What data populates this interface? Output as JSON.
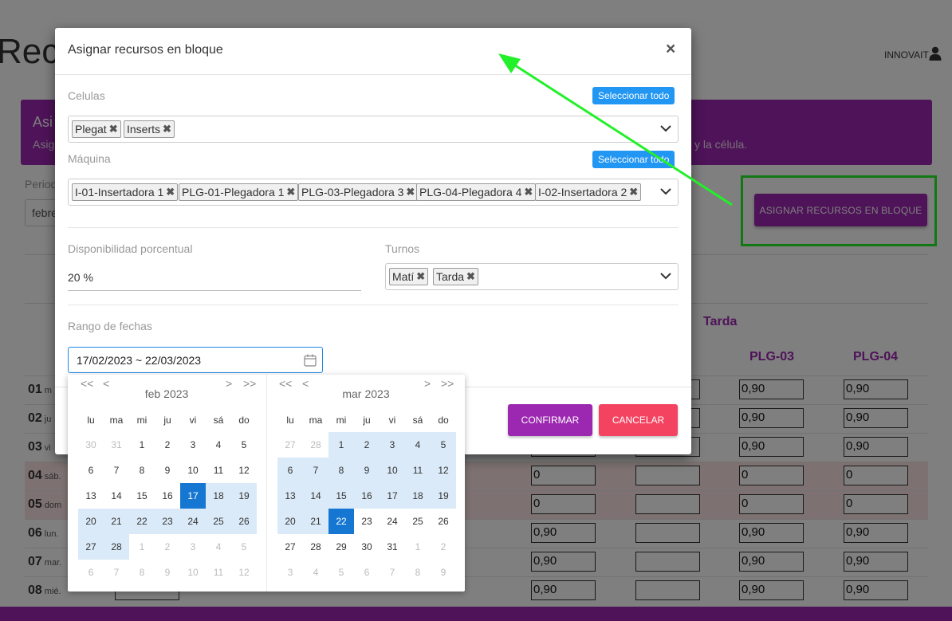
{
  "background": {
    "page_title": "Rec",
    "user_name": "INNOVAIT",
    "card_title": "Asi",
    "card_subtitle": "Asig",
    "card_subtitle_right": "y la célula.",
    "periodo_label": "Period",
    "periodo_value": "febre",
    "bulk_button_label": "ASIGNAR RECURSOS EN BLOQUE",
    "tarda_header": "Tarda",
    "column_headers": [
      "PLG-03",
      "PLG-04"
    ],
    "rows": [
      {
        "num": "01",
        "wd": "m",
        "vals": [
          "",
          "",
          "0,90",
          "0,90"
        ],
        "weekend": false
      },
      {
        "num": "02",
        "wd": "ju",
        "vals": [
          "",
          "",
          "0,90",
          "0,90"
        ],
        "weekend": false
      },
      {
        "num": "03",
        "wd": "vi",
        "vals": [
          "",
          "",
          "0,90",
          "0,90"
        ],
        "weekend": false
      },
      {
        "num": "04",
        "wd": "sáb.",
        "vals": [
          "0",
          "",
          "0",
          "0"
        ],
        "weekend": true
      },
      {
        "num": "05",
        "wd": "dom",
        "vals": [
          "0",
          "",
          "0",
          "0"
        ],
        "weekend": true
      },
      {
        "num": "06",
        "wd": "lun.",
        "vals": [
          "0,90",
          "",
          "0,90",
          "0,90"
        ],
        "weekend": false
      },
      {
        "num": "07",
        "wd": "mar.",
        "vals": [
          "0,90",
          "",
          "0,90",
          "0,90"
        ],
        "weekend": false
      },
      {
        "num": "08",
        "wd": "mié.",
        "vals": [
          "0,90",
          "",
          "0,90",
          "0,90"
        ],
        "weekend": false
      }
    ]
  },
  "modal": {
    "title": "Asignar recursos en bloque",
    "close_glyph": "×",
    "celulas": {
      "label": "Celulas",
      "select_all": "Seleccionar todo",
      "chips": [
        "Plegat",
        "Inserts"
      ]
    },
    "maquina": {
      "label": "Máquina",
      "select_all": "Seleccionar todo",
      "chips": [
        "I-01-Insertadora 1",
        "PLG-01-Plegadora 1",
        "PLG-03-Plegadora 3",
        "PLG-04-Plegadora 4",
        "I-02-Insertadora 2"
      ]
    },
    "disponibilidad": {
      "label": "Disponibilidad porcentual",
      "value": "20 %"
    },
    "turnos": {
      "label": "Turnos",
      "chips": [
        "Matí",
        "Tarda"
      ]
    },
    "rango": {
      "label": "Rango de fechas",
      "value": "17/02/2023 ~ 22/03/2023"
    },
    "confirm_label": "CONFIRMAR",
    "cancel_label": "CANCELAR",
    "chip_remove_glyph": "✖"
  },
  "calendar": {
    "weekdays": [
      "lu",
      "ma",
      "mi",
      "ju",
      "vi",
      "sá",
      "do"
    ],
    "nav": {
      "prev_year": "<<",
      "prev_month": "<",
      "next_month": ">",
      "next_year": ">>"
    },
    "left": {
      "month": "feb",
      "year": "2023",
      "days": [
        [
          "30",
          "m"
        ],
        [
          "31",
          "m"
        ],
        [
          "1",
          ""
        ],
        [
          "2",
          ""
        ],
        [
          "3",
          ""
        ],
        [
          "4",
          ""
        ],
        [
          "5",
          ""
        ],
        [
          "6",
          ""
        ],
        [
          "7",
          ""
        ],
        [
          "8",
          ""
        ],
        [
          "9",
          ""
        ],
        [
          "10",
          ""
        ],
        [
          "11",
          ""
        ],
        [
          "12",
          ""
        ],
        [
          "13",
          ""
        ],
        [
          "14",
          ""
        ],
        [
          "15",
          ""
        ],
        [
          "16",
          ""
        ],
        [
          "17",
          "s"
        ],
        [
          "18",
          "r"
        ],
        [
          "19",
          "r"
        ],
        [
          "20",
          "r"
        ],
        [
          "21",
          "r"
        ],
        [
          "22",
          "r"
        ],
        [
          "23",
          "r"
        ],
        [
          "24",
          "r"
        ],
        [
          "25",
          "r"
        ],
        [
          "26",
          "r"
        ],
        [
          "27",
          "r"
        ],
        [
          "28",
          "r"
        ],
        [
          "1",
          "m"
        ],
        [
          "2",
          "m"
        ],
        [
          "3",
          "m"
        ],
        [
          "4",
          "m"
        ],
        [
          "5",
          "m"
        ],
        [
          "6",
          "m"
        ],
        [
          "7",
          "m"
        ],
        [
          "8",
          "m"
        ],
        [
          "9",
          "m"
        ],
        [
          "10",
          "m"
        ],
        [
          "11",
          "m"
        ],
        [
          "12",
          "m"
        ]
      ]
    },
    "right": {
      "month": "mar",
      "year": "2023",
      "days": [
        [
          "27",
          "m"
        ],
        [
          "28",
          "m"
        ],
        [
          "1",
          "r"
        ],
        [
          "2",
          "r"
        ],
        [
          "3",
          "r"
        ],
        [
          "4",
          "r"
        ],
        [
          "5",
          "r"
        ],
        [
          "6",
          "r"
        ],
        [
          "7",
          "r"
        ],
        [
          "8",
          "r"
        ],
        [
          "9",
          "r"
        ],
        [
          "10",
          "r"
        ],
        [
          "11",
          "r"
        ],
        [
          "12",
          "r"
        ],
        [
          "13",
          "r"
        ],
        [
          "14",
          "r"
        ],
        [
          "15",
          "r"
        ],
        [
          "16",
          "r"
        ],
        [
          "17",
          "r"
        ],
        [
          "18",
          "r"
        ],
        [
          "19",
          "r"
        ],
        [
          "20",
          "r"
        ],
        [
          "21",
          "r"
        ],
        [
          "22",
          "s"
        ],
        [
          "23",
          ""
        ],
        [
          "24",
          ""
        ],
        [
          "25",
          ""
        ],
        [
          "26",
          ""
        ],
        [
          "27",
          ""
        ],
        [
          "28",
          ""
        ],
        [
          "29",
          ""
        ],
        [
          "30",
          ""
        ],
        [
          "31",
          ""
        ],
        [
          "1",
          "m"
        ],
        [
          "2",
          "m"
        ],
        [
          "3",
          "m"
        ],
        [
          "4",
          "m"
        ],
        [
          "5",
          "m"
        ],
        [
          "6",
          "m"
        ],
        [
          "7",
          "m"
        ],
        [
          "8",
          "m"
        ],
        [
          "9",
          "m"
        ]
      ]
    }
  },
  "colors": {
    "brand_purple": "#9c27b0",
    "select_all_blue": "#2196f3",
    "cancel_red": "#f44360",
    "selected_day": "#1677d2",
    "range_day": "#daeaf8",
    "annotation_green": "#22f028"
  }
}
